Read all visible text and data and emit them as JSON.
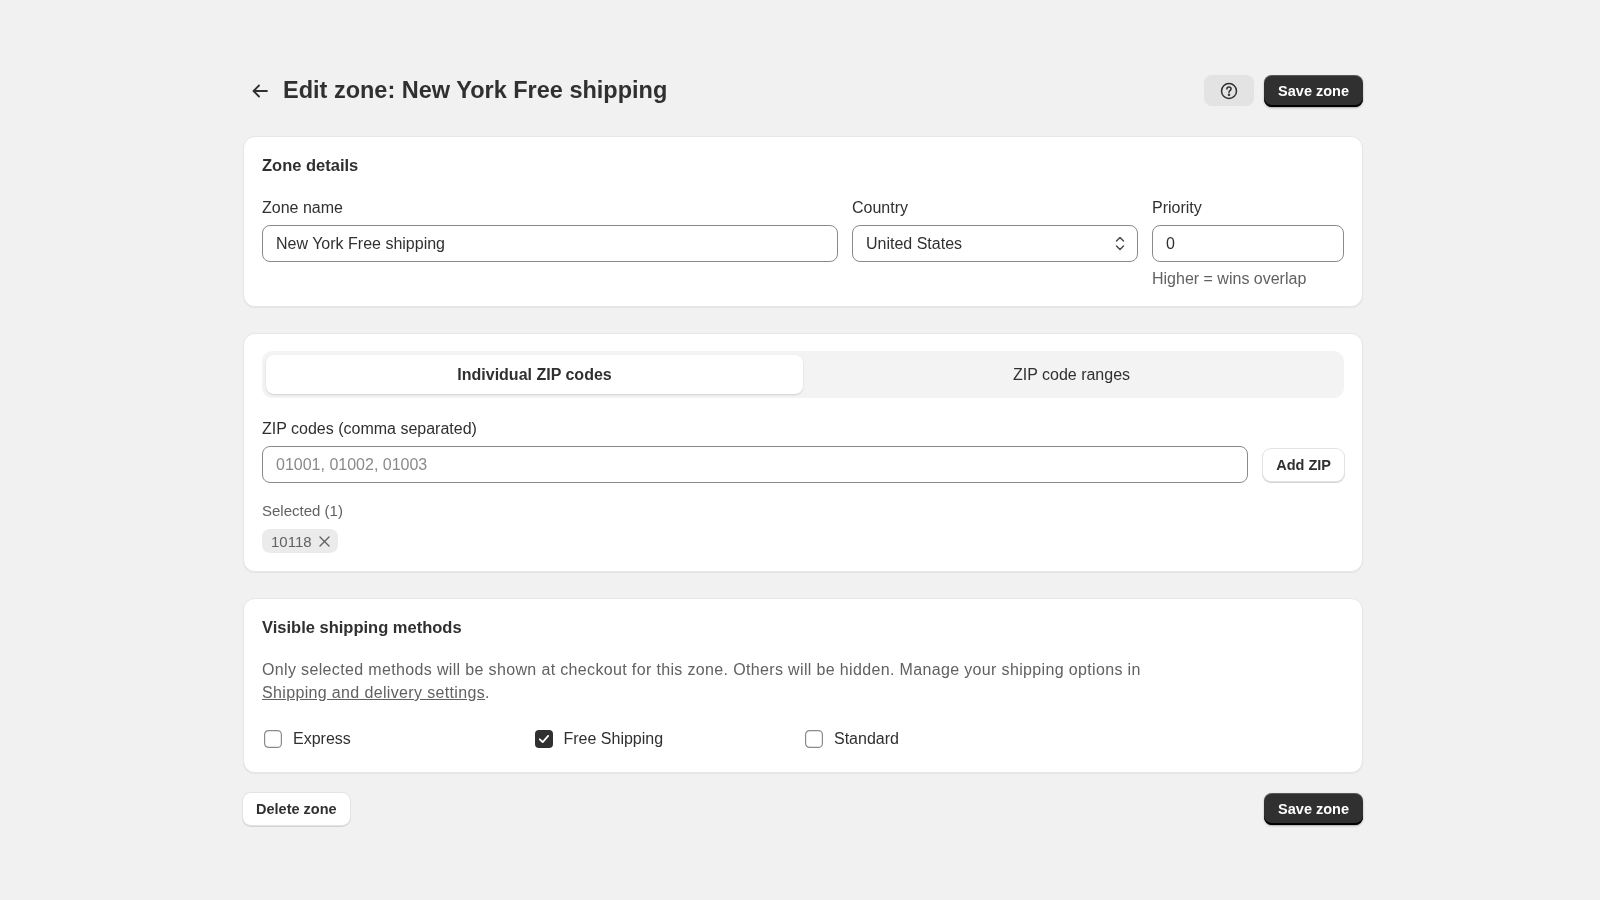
{
  "header": {
    "title": "Edit zone: New York Free shipping",
    "save_button": "Save zone"
  },
  "zone_details": {
    "title": "Zone details",
    "fields": [
      {
        "kind": "text",
        "label": "Zone name",
        "value": "New York Free shipping"
      },
      {
        "kind": "select",
        "label": "Country",
        "value": "United States"
      },
      {
        "kind": "text",
        "label": "Priority",
        "value": "0",
        "hint": "Higher = wins overlap"
      }
    ]
  },
  "zip_codes": {
    "tabs": [
      {
        "label": "Individual ZIP codes",
        "selected": true
      },
      {
        "label": "ZIP code ranges",
        "selected": false
      }
    ],
    "input_label": "ZIP codes (comma separated)",
    "placeholder": "01001, 01002, 01003",
    "add_button": "Add ZIP",
    "selected_label": "Selected (1)",
    "chips": [
      {
        "label": "10118"
      }
    ]
  },
  "shipping_methods": {
    "title": "Visible shipping methods",
    "description": "Only selected methods will be shown at checkout for this zone. Others will be hidden. Manage your shipping options in ",
    "link": "Shipping and delivery settings",
    "description_end": ".",
    "methods": [
      {
        "label": "Express",
        "checked": false
      },
      {
        "label": "Free Shipping",
        "checked": true
      },
      {
        "label": "Standard",
        "checked": false
      }
    ]
  },
  "footer": {
    "delete_button": "Delete zone",
    "save_button": "Save zone"
  }
}
